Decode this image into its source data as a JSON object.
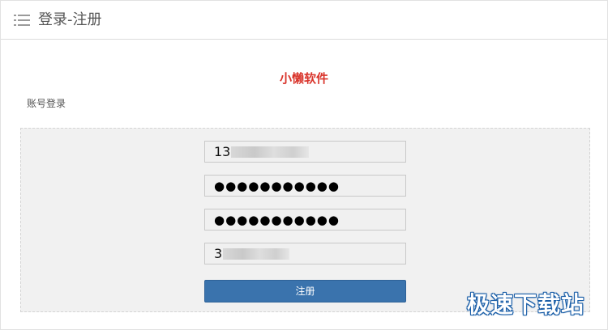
{
  "header": {
    "menu_icon": "list-menu-icon",
    "title": "登录-注册"
  },
  "brand": {
    "name": "小懒软件"
  },
  "section": {
    "label": "账号登录"
  },
  "form": {
    "phone_value": "13",
    "password_value": "●●●●●●●●●●●",
    "confirm_password_value": "●●●●●●●●●●●",
    "code_value": "3",
    "submit_label": "注册"
  },
  "watermark": {
    "text": "极速下载站"
  },
  "colors": {
    "brand_red": "#d9342b",
    "button_blue": "#3a73ad",
    "form_bg": "#f1f1f1"
  }
}
